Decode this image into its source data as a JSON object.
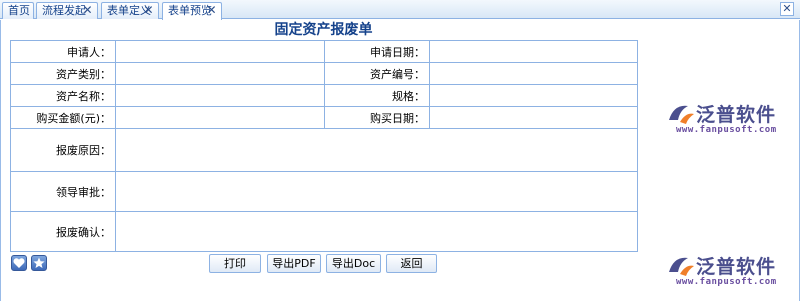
{
  "tabs": [
    {
      "label": "首页",
      "closable": false,
      "active": false
    },
    {
      "label": "流程发起",
      "closable": true,
      "active": false
    },
    {
      "label": "表单定义",
      "closable": true,
      "active": false
    },
    {
      "label": "表单预览",
      "closable": true,
      "active": true
    }
  ],
  "window_close_icon": "close-icon",
  "form": {
    "title": "固定资产报废单",
    "fields": {
      "applicant": "申请人：",
      "apply_date": "申请日期：",
      "asset_category": "资产类别：",
      "asset_number": "资产编号：",
      "asset_name": "资产名称：",
      "spec": "规格：",
      "purchase_amount": "购买金额(元)：",
      "purchase_date": "购买日期：",
      "scrap_reason": "报废原因：",
      "leader_approval": "领导审批：",
      "scrap_confirm": "报废确认："
    }
  },
  "buttons": {
    "print": "打印",
    "export_pdf": "导出PDF",
    "export_doc": "导出Doc",
    "back": "返回"
  },
  "icons": [
    "heart-icon",
    "star-icon"
  ],
  "watermark": {
    "brand": "泛普软件",
    "url": "www.fanpusoft.com"
  },
  "colors": {
    "accent": "#15428b",
    "border": "#8db2e3",
    "logo_brand": "#4b4f8e"
  }
}
